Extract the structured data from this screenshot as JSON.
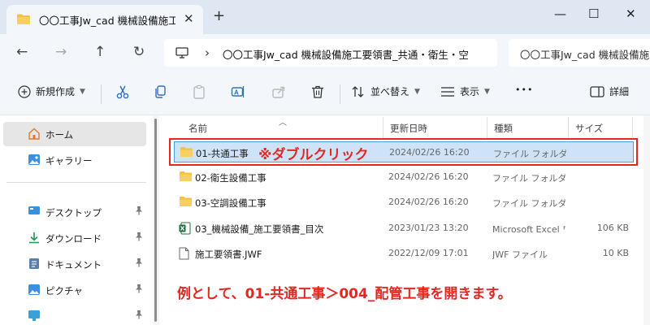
{
  "window": {
    "tab_title": "〇〇工事Jw_cad 機械設備施工要領書_共通・衛生・空",
    "tab_close": "✕",
    "new_tab": "+",
    "minimize": "—",
    "maximize": "☐",
    "close": "✕"
  },
  "nav": {
    "back": "←",
    "forward": "→",
    "up": "↑",
    "refresh": "↻",
    "breadcrumb_sep": "›",
    "address_path": "〇〇工事Jw_cad 機械設備施工要領書_共通・衛生・空",
    "search_text": "〇〇工事Jw_cad 機械設備施"
  },
  "toolbar": {
    "new_label": "新規作成",
    "sort_label": "並べ替え",
    "view_label": "表示",
    "more": "•••",
    "details_label": "詳細"
  },
  "sidebar": {
    "items": [
      {
        "label": "ホーム",
        "icon": "home-icon"
      },
      {
        "label": "ギャラリー",
        "icon": "gallery-icon"
      },
      {
        "label": "デスクトップ",
        "icon": "desktop-icon"
      },
      {
        "label": "ダウンロード",
        "icon": "download-icon"
      },
      {
        "label": "ドキュメント",
        "icon": "documents-icon"
      },
      {
        "label": "ピクチャ",
        "icon": "pictures-icon"
      },
      {
        "label": "",
        "icon": "monitor-icon"
      }
    ],
    "pin_glyph": "📌"
  },
  "columns": {
    "name": "名前",
    "date": "更新日時",
    "type": "種類",
    "size": "サイズ"
  },
  "files": [
    {
      "name": "01-共通工事",
      "date": "2024/02/26 16:20",
      "type": "ファイル フォルダー",
      "size": "",
      "icon": "folder-icon"
    },
    {
      "name": "02-衛生設備工事",
      "date": "2024/02/26 16:20",
      "type": "ファイル フォルダー",
      "size": "",
      "icon": "folder-icon"
    },
    {
      "name": "03-空調設備工事",
      "date": "2024/02/26 16:20",
      "type": "ファイル フォルダー",
      "size": "",
      "icon": "folder-icon"
    },
    {
      "name": "03_機械設備_施工要領書_目次",
      "date": "2023/01/23 13:20",
      "type": "Microsoft Excel ワークシート",
      "size": "106 KB",
      "icon": "excel-icon"
    },
    {
      "name": "施工要領書.JWF",
      "date": "2022/12/09 17:01",
      "type": "JWF ファイル",
      "size": "10 KB",
      "icon": "file-icon"
    }
  ],
  "annotations": {
    "double_click": "※ダブルクリック",
    "instruction": "例として、01-共通工事＞004_配管工事を開きます。"
  },
  "colors": {
    "accent_red": "#e32722",
    "selection_bg": "#cfe3f8",
    "selection_border": "#4d9ae0",
    "folder_yellow": "#f4c144",
    "chrome_bg": "#f3f6fb"
  }
}
